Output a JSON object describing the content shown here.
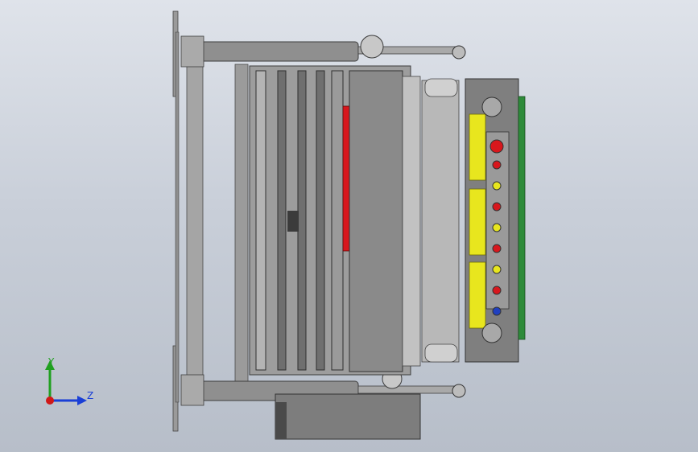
{
  "viewport": {
    "background_top": "#dfe3ea",
    "background_bottom": "#b7bec9"
  },
  "model": {
    "body_color": "#8c8c8c",
    "frame_color": "#9c9c9c",
    "dark_color": "#3a3a3a",
    "panel_yellow": "#e8e61e",
    "accent_red": "#d8171d",
    "side_green": "#2e8b3a",
    "button_colors": [
      "red",
      "yellow",
      "red",
      "yellow",
      "red",
      "yellow",
      "red",
      "blue"
    ]
  },
  "triad": {
    "y_label": "Y",
    "z_label": "Z",
    "y_color": "#20a020",
    "z_color": "#1a3fd6",
    "x_color": "#d01818"
  }
}
